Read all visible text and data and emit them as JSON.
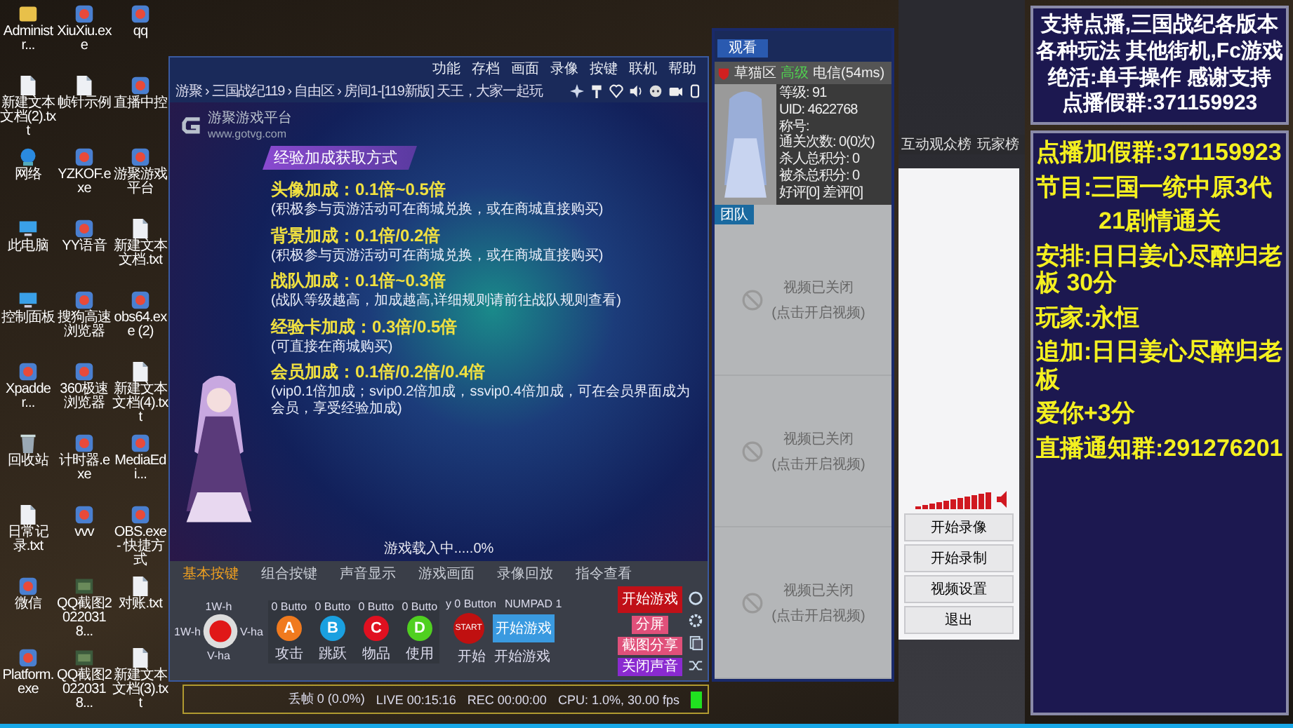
{
  "desktop_icons": [
    {
      "label": "Administr...",
      "kind": "user"
    },
    {
      "label": "XiuXiu.exe",
      "kind": "app"
    },
    {
      "label": "qq",
      "kind": "app"
    },
    {
      "label": "新建文本文档(2).txt",
      "kind": "doc"
    },
    {
      "label": "帧针示例",
      "kind": "doc"
    },
    {
      "label": "直播中控",
      "kind": "app"
    },
    {
      "label": "网络",
      "kind": "globe"
    },
    {
      "label": "YZKOF.exe",
      "kind": "app"
    },
    {
      "label": "游聚游戏平台",
      "kind": "app"
    },
    {
      "label": "此电脑",
      "kind": "pc"
    },
    {
      "label": "YY语音",
      "kind": "app"
    },
    {
      "label": "新建文本文档.txt",
      "kind": "doc"
    },
    {
      "label": "控制面板",
      "kind": "pc"
    },
    {
      "label": "搜狗高速浏览器",
      "kind": "app"
    },
    {
      "label": "obs64.exe (2)",
      "kind": "app"
    },
    {
      "label": "Xpadder...",
      "kind": "app"
    },
    {
      "label": "360极速浏览器",
      "kind": "app"
    },
    {
      "label": "新建文本文档(4).txt",
      "kind": "doc"
    },
    {
      "label": "回收站",
      "kind": "bin"
    },
    {
      "label": "计时器.exe",
      "kind": "app"
    },
    {
      "label": "MediaEdi...",
      "kind": "app"
    },
    {
      "label": "日常记录.txt",
      "kind": "doc"
    },
    {
      "label": "vvv",
      "kind": "app"
    },
    {
      "label": "OBS.exe - 快捷方式",
      "kind": "app"
    },
    {
      "label": "微信",
      "kind": "app"
    },
    {
      "label": "QQ截图20220318...",
      "kind": "image"
    },
    {
      "label": "对账.txt",
      "kind": "doc"
    },
    {
      "label": "Platform.exe",
      "kind": "app"
    },
    {
      "label": "QQ截图20220318...",
      "kind": "image"
    },
    {
      "label": "新建文本文档(3).txt",
      "kind": "doc"
    }
  ],
  "game_window": {
    "menu": [
      "功能",
      "存档",
      "画面",
      "录像",
      "按键",
      "联机",
      "帮助"
    ],
    "breadcrumb": "游聚 › 三国战纪119 › 自由区 › 房间1-[119新版] 天王，大家一起玩",
    "logo_name": "游聚游戏平台",
    "logo_url": "www.gotvg.com",
    "heading": "经验加成获取方式",
    "bonuses": [
      {
        "title": "头像加成：0.1倍~0.5倍",
        "note": "(积极参与贡游活动可在商城兑换，或在商城直接购买)"
      },
      {
        "title": "背景加成：0.1倍/0.2倍",
        "note": "(积极参与贡游活动可在商城兑换，或在商城直接购买)"
      },
      {
        "title": "战队加成：0.1倍~0.3倍",
        "note": "(战队等级越高，加成越高,详细规则请前往战队规则查看)"
      },
      {
        "title": "经验卡加成：0.3倍/0.5倍",
        "note": "(可直接在商城购买)"
      },
      {
        "title": "会员加成：0.1倍/0.2倍/0.4倍",
        "note": "(vip0.1倍加成；svip0.2倍加成，ssvip0.4倍加成，可在会员界面成为会员，享受经验加成)"
      }
    ],
    "loading": "游戏载入中.....0%",
    "control_panel": {
      "tabs": [
        {
          "label": "基本按键",
          "selected": true
        },
        {
          "label": "组合按键",
          "selected": false
        },
        {
          "label": "声音显示",
          "selected": false
        },
        {
          "label": "游戏画面",
          "selected": false
        },
        {
          "label": "录像回放",
          "selected": false
        },
        {
          "label": "指令查看",
          "selected": false
        }
      ],
      "stick": {
        "up": "1W-h",
        "left": "1W-h",
        "right": "V-ha",
        "down": "V-ha"
      },
      "keys": [
        {
          "header": "0 Butto",
          "letter": "A",
          "label": "攻击",
          "color": "#f07a1e"
        },
        {
          "header": "0 Butto",
          "letter": "B",
          "label": "跳跃",
          "color": "#1aa0e0"
        },
        {
          "header": "0 Butto",
          "letter": "C",
          "label": "物品",
          "color": "#e01020"
        },
        {
          "header": "0 Butto",
          "letter": "D",
          "label": "使用",
          "color": "#50d020"
        }
      ],
      "start_headers": [
        "y 0 Button",
        "NUMPAD 1"
      ],
      "start_key": "START",
      "start_game_key": "开始游戏",
      "start_labels": [
        "开始",
        "开始游戏"
      ],
      "actions": [
        {
          "label": "开始游戏",
          "kind": "primary"
        },
        {
          "label": "分屏",
          "kind": "pink"
        },
        {
          "label": "截图分享",
          "kind": "pink"
        },
        {
          "label": "关闭声音",
          "kind": "purple"
        }
      ]
    }
  },
  "status_bar": [
    "丢帧 0 (0.0%)",
    "LIVE 00:15:16",
    "REC 00:00:00",
    "CPU: 1.0%, 30.00 fps"
  ],
  "watch_panel": {
    "tab": "观看",
    "room": "草猫区",
    "signal": "高级",
    "latency": "电信(54ms)",
    "stats": [
      "等级: 91",
      "UID: 4622768",
      "称号:",
      "通关次数: 0(0次)",
      "杀人总积分: 0",
      "被杀总积分: 0",
      "好评[0] 差评[0]"
    ],
    "team": "团队",
    "videos": [
      {
        "status": "视频已关闭",
        "hint": "(点击开启视频)"
      },
      {
        "status": "视频已关闭",
        "hint": "(点击开启视频)"
      },
      {
        "status": "视频已关闭",
        "hint": "(点击开启视频)"
      }
    ]
  },
  "recorder": {
    "tabs": [
      "互动观众榜",
      "玩家榜"
    ],
    "buttons": [
      "开始录像",
      "开始录制",
      "视频设置",
      "退出"
    ]
  },
  "overlay": {
    "intro": [
      "支持点播,三国战纪各版本",
      "各种玩法 其他街机,Fc游戏",
      "绝活:单手操作 感谢支持",
      "点播假群:371159923"
    ],
    "schedule": [
      "点播加假群:371159923",
      "节目:三国一统中原3代",
      "21剧情通关",
      "安排:日日姜心尽醉归老板 30分",
      "玩家:永恒",
      "追加:日日姜心尽醉归老板",
      "爱你+3分",
      "直播通知群:291276201"
    ]
  }
}
